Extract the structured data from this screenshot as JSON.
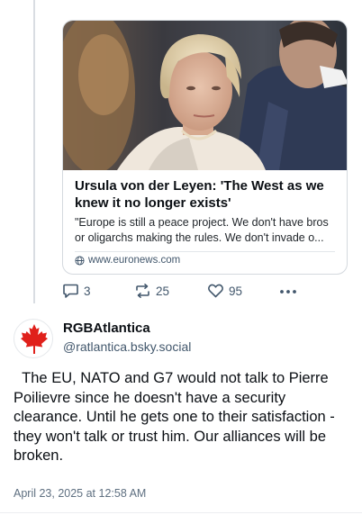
{
  "link_card": {
    "title": "Ursula von der Leyen: 'The West as we knew it no longer exists'",
    "description": "\"Europe is still a peace project. We don't have bros or oligarchs making the rules. We don't invade o...",
    "domain": "www.euronews.com"
  },
  "actions": {
    "replies": "3",
    "reposts": "25",
    "likes": "95"
  },
  "post": {
    "display_name": "RGBAtlantica",
    "handle": "@ratlantica.bsky.social",
    "text": "  The EU, NATO and G7 would not talk to Pierre Poilievre since he doesn't have a security clearance. Until he gets one to their satisfaction -they won't talk or trust him. Our alliances will be broken.",
    "timestamp": "April 23, 2025 at 12:58 AM"
  },
  "colors": {
    "muted": "#42576c",
    "maple_red": "#e0201b"
  }
}
